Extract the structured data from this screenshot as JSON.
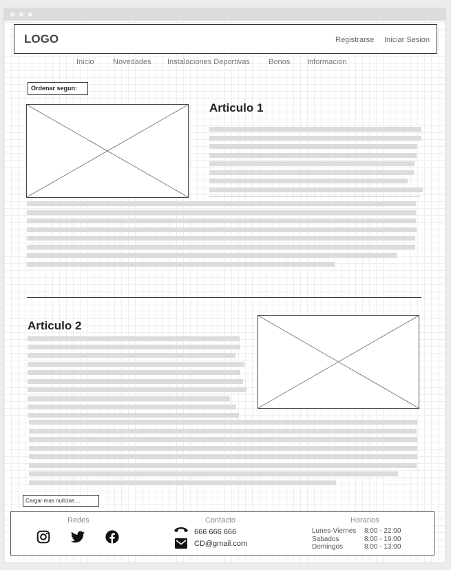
{
  "header": {
    "logo": "LOGO",
    "register": "Registrarse",
    "login": "Iniciar Sesion"
  },
  "nav": [
    "Inicio",
    "Novedades",
    "Instalaciones Deportivas",
    "Bonos",
    "Informacion"
  ],
  "sort_button": "Ordenar segun:",
  "articles": [
    {
      "title": "Articulo 1"
    },
    {
      "title": "Articulo 2"
    }
  ],
  "load_more": "Cargar mas nuticias ...",
  "footer": {
    "social_heading": "Redes",
    "social_icons": [
      "instagram-icon",
      "twitter-icon",
      "facebook-icon"
    ],
    "contact_heading": "Contacto",
    "phone": "666 666 666",
    "email": "CD@gmail.com",
    "hours_heading": "Horarios",
    "hours": [
      {
        "day": "Lunes-Viernes",
        "time": "8:00 - 22:00"
      },
      {
        "day": "Sabados",
        "time": "8:00 - 19:00"
      },
      {
        "day": "Domingos",
        "time": "8:00 - 13:00"
      }
    ]
  },
  "colors": {
    "placeholder_line": "#dcdcdc",
    "border": "#333333",
    "grid": "#eeeeee"
  }
}
